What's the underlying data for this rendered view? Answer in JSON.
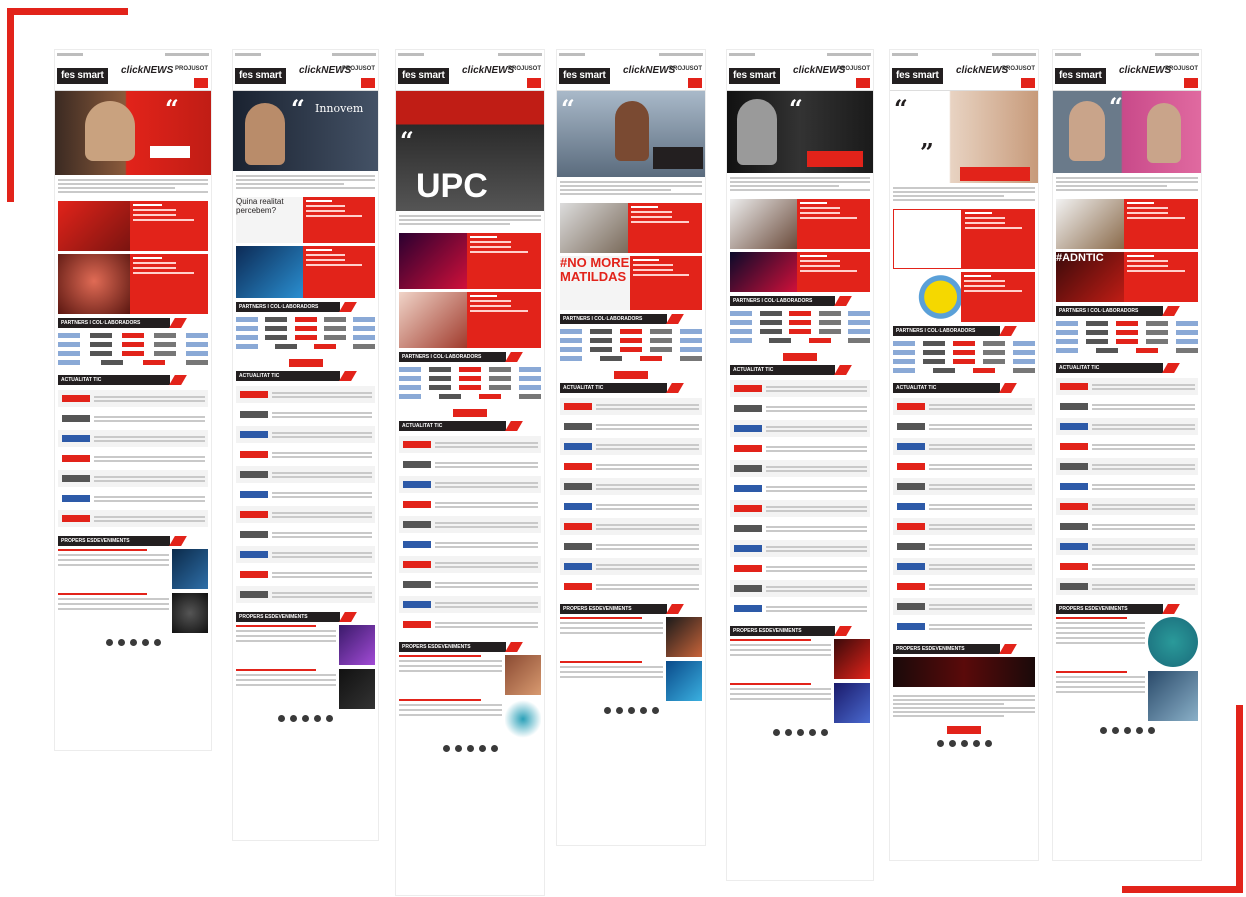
{
  "accent": "#e2231a",
  "newsletter": {
    "logo": "fes smart",
    "brand": "clickNEWS",
    "brand2": "PROJUSOT",
    "section_partners": "PARTNERS I COL·LABORADORS",
    "section_news": "ACTUALITAT TIC",
    "section_events": "PROPERS ESDEVENIMENTS",
    "icons": [
      "calendar-icon",
      "facebook-icon",
      "twitter-icon",
      "linkedin-icon",
      "youtube-icon"
    ]
  },
  "issues": [
    {
      "id": 1,
      "hero_text": "",
      "extra": ""
    },
    {
      "id": 2,
      "hero_text": "Innovem",
      "extra": "Quina realitat percebem?"
    },
    {
      "id": 3,
      "hero_text": "UPC",
      "extra": ""
    },
    {
      "id": 4,
      "hero_text": "",
      "extra": "#NO MORE MATILDAS"
    },
    {
      "id": 5,
      "hero_text": "",
      "extra": ""
    },
    {
      "id": 6,
      "hero_text": "",
      "extra": ""
    },
    {
      "id": 7,
      "hero_text": "",
      "extra": "#ADNTIC"
    }
  ]
}
